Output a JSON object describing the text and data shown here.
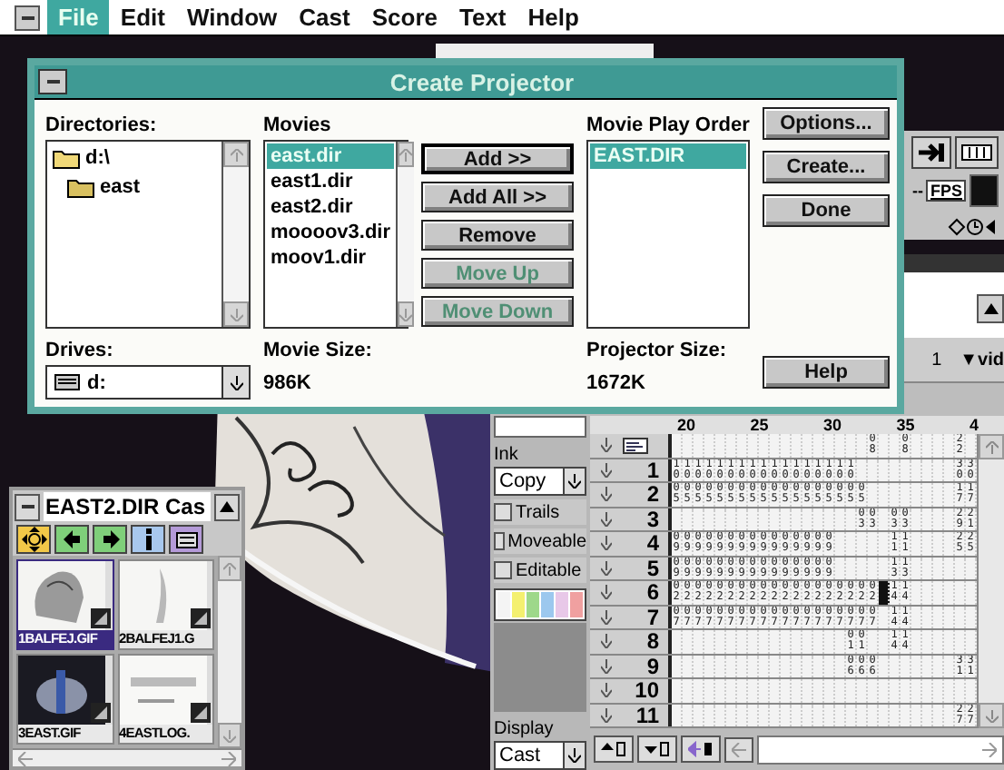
{
  "menu_bar": {
    "items": [
      {
        "label": "File",
        "selected": true
      },
      {
        "label": "Edit",
        "selected": false
      },
      {
        "label": "Window",
        "selected": false
      },
      {
        "label": "Cast",
        "selected": false
      },
      {
        "label": "Score",
        "selected": false
      },
      {
        "label": "Text",
        "selected": false
      },
      {
        "label": "Help",
        "selected": false
      }
    ]
  },
  "dialog": {
    "title": "Create Projector",
    "directories": {
      "label": "Directories:",
      "items": [
        {
          "label": "d:\\",
          "children": [
            {
              "label": "east"
            }
          ]
        }
      ]
    },
    "movies": {
      "label": "Movies",
      "items": [
        {
          "label": "east.dir",
          "selected": true
        },
        {
          "label": "east1.dir",
          "selected": false
        },
        {
          "label": "east2.dir",
          "selected": false
        },
        {
          "label": "moooov3.dir",
          "selected": false
        },
        {
          "label": "moov1.dir",
          "selected": false
        }
      ]
    },
    "move_buttons": [
      {
        "label": "Add >>",
        "disabled": false,
        "default": true
      },
      {
        "label": "Add All >>",
        "disabled": false,
        "default": false
      },
      {
        "label": "Remove",
        "disabled": false,
        "default": false
      },
      {
        "label": "Move Up",
        "disabled": true,
        "default": false
      },
      {
        "label": "Move Down",
        "disabled": true,
        "default": false
      }
    ],
    "play_order": {
      "label": "Movie Play Order",
      "items": [
        {
          "label": "EAST.DIR",
          "selected": true
        }
      ]
    },
    "action_buttons": [
      {
        "label": "Options..."
      },
      {
        "label": "Create..."
      },
      {
        "label": "Done"
      }
    ],
    "help_button": {
      "label": "Help"
    },
    "drives": {
      "label": "Drives:",
      "value": "d:"
    },
    "movie_size": {
      "label": "Movie Size:",
      "value": "986K"
    },
    "projector_size": {
      "label": "Projector Size:",
      "value": "1672K"
    }
  },
  "control_panel": {
    "tempo": "--",
    "tempo_unit": "FPS"
  },
  "score": {
    "frame": "1",
    "channel_menu": "▼vid",
    "frame_numbers": [
      "20",
      "25",
      "30",
      "35",
      "4"
    ],
    "ink": {
      "label": "Ink",
      "value": "Copy"
    },
    "options": [
      {
        "label": "Trails",
        "checked": false
      },
      {
        "label": "Moveable",
        "checked": false
      },
      {
        "label": "Editable",
        "checked": false
      }
    ],
    "display": {
      "label": "Display",
      "value": "Cast"
    },
    "channels": [
      {
        "kind": "script",
        "cells": [
          null,
          null,
          null,
          null,
          null,
          null,
          null,
          null,
          null,
          null,
          null,
          null,
          null,
          null,
          null,
          null,
          null,
          null,
          "08",
          null,
          null,
          "08",
          null,
          null,
          null,
          null,
          "22",
          null
        ]
      },
      {
        "kind": "sprite",
        "label": "1",
        "cells": [
          "10",
          "10",
          "10",
          "10",
          "10",
          "10",
          "10",
          "10",
          "10",
          "10",
          "10",
          "10",
          "10",
          "10",
          "10",
          "10",
          "10",
          null,
          null,
          null,
          null,
          null,
          null,
          null,
          null,
          null,
          "30",
          "30"
        ]
      },
      {
        "kind": "sprite",
        "label": "2",
        "cells": [
          "05",
          "05",
          "05",
          "05",
          "05",
          "05",
          "05",
          "05",
          "05",
          "05",
          "05",
          "05",
          "05",
          "05",
          "05",
          "05",
          "05",
          "05",
          null,
          null,
          null,
          null,
          null,
          null,
          null,
          null,
          "17",
          "17"
        ]
      },
      {
        "kind": "sprite",
        "label": "3",
        "cells": [
          null,
          null,
          null,
          null,
          null,
          null,
          null,
          null,
          null,
          null,
          null,
          null,
          null,
          null,
          null,
          null,
          null,
          "03",
          "03",
          null,
          "03",
          "03",
          null,
          null,
          null,
          null,
          "29",
          "21"
        ]
      },
      {
        "kind": "sprite",
        "label": "4",
        "cells": [
          "09",
          "09",
          "09",
          "09",
          "09",
          "09",
          "09",
          "09",
          "09",
          "09",
          "09",
          "09",
          "09",
          "09",
          "09",
          null,
          null,
          null,
          null,
          null,
          "11",
          "11",
          null,
          null,
          null,
          null,
          "25",
          "25"
        ]
      },
      {
        "kind": "sprite",
        "label": "5",
        "cells": [
          "09",
          "09",
          "09",
          "09",
          "09",
          "09",
          "09",
          "09",
          "09",
          "09",
          "09",
          "09",
          "09",
          "09",
          "09",
          null,
          null,
          null,
          null,
          null,
          "13",
          "13",
          null,
          null,
          null,
          null,
          null,
          null
        ]
      },
      {
        "kind": "sprite",
        "label": "6",
        "cells": [
          "02",
          "02",
          "02",
          "02",
          "02",
          "02",
          "02",
          "02",
          "02",
          "02",
          "02",
          "02",
          "02",
          "02",
          "02",
          "02",
          "02",
          "02",
          "02",
          {
            "selected": true
          },
          "14",
          "14",
          null,
          null,
          null,
          null,
          null,
          null
        ]
      },
      {
        "kind": "sprite",
        "label": "7",
        "cells": [
          "07",
          "07",
          "07",
          "07",
          "07",
          "07",
          "07",
          "07",
          "07",
          "07",
          "07",
          "07",
          "07",
          "07",
          "07",
          "07",
          "07",
          "07",
          "07",
          null,
          "14",
          "14",
          null,
          null,
          null,
          null,
          null,
          null
        ]
      },
      {
        "kind": "sprite",
        "label": "8",
        "cells": [
          null,
          null,
          null,
          null,
          null,
          null,
          null,
          null,
          null,
          null,
          null,
          null,
          null,
          null,
          null,
          null,
          "01",
          "01",
          null,
          null,
          "14",
          "14",
          null,
          null,
          null,
          null,
          null,
          null
        ]
      },
      {
        "kind": "sprite",
        "label": "9",
        "cells": [
          null,
          null,
          null,
          null,
          null,
          null,
          null,
          null,
          null,
          null,
          null,
          null,
          null,
          null,
          null,
          null,
          "06",
          "06",
          "06",
          null,
          null,
          null,
          null,
          null,
          null,
          null,
          "31",
          "31"
        ]
      },
      {
        "kind": "sprite",
        "label": "10",
        "cells": [
          null,
          null,
          null,
          null,
          null,
          null,
          null,
          null,
          null,
          null,
          null,
          null,
          null,
          null,
          null,
          null,
          null,
          null,
          null,
          null,
          null,
          null,
          null,
          null,
          null,
          null,
          null,
          null
        ]
      },
      {
        "kind": "sprite",
        "label": "11",
        "cells": [
          null,
          null,
          null,
          null,
          null,
          null,
          null,
          null,
          null,
          null,
          null,
          null,
          null,
          null,
          null,
          null,
          null,
          null,
          null,
          null,
          null,
          null,
          null,
          null,
          null,
          null,
          "27",
          "27"
        ]
      }
    ]
  },
  "cast": {
    "title": "EAST2.DIR Cas",
    "members": [
      {
        "label": "1BALFEJ.GIF",
        "selected": true
      },
      {
        "label": "2BALFEJ1.G",
        "selected": false
      },
      {
        "label": "3EAST.GIF",
        "selected": false
      },
      {
        "label": "4EASTLOG.",
        "selected": false
      }
    ]
  }
}
